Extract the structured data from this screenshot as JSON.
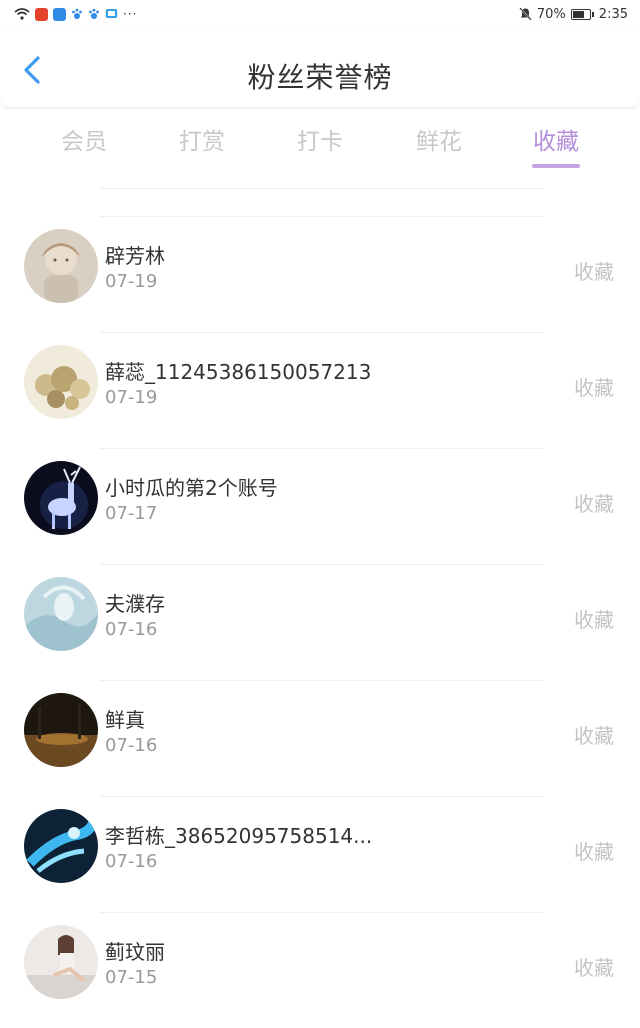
{
  "status_bar": {
    "battery": "70%",
    "time": "2:35",
    "icons": [
      "wifi-icon",
      "app-icon-red",
      "cloud-icon",
      "paw-icon",
      "paw-icon",
      "tv-icon",
      "more-icon",
      "mute-icon",
      "battery-icon"
    ],
    "colors": {
      "app_red": "#e2412c",
      "app_blue": "#2f8be5"
    }
  },
  "header": {
    "title": "粉丝荣誉榜",
    "back_icon": "chevron-left-icon",
    "accent": "#3b9cf0"
  },
  "tabs": {
    "items": [
      "会员",
      "打赏",
      "打卡",
      "鲜花",
      "收藏"
    ],
    "active_index": 4,
    "active_color": "#b48fd9",
    "inactive_color": "#c8c8c8"
  },
  "fans": [
    {
      "name": "辟芳林",
      "date": "07-19",
      "action": "收藏",
      "avatar": "avatar-sketch-girl"
    },
    {
      "name": "薛蕊_11245386150057213",
      "date": "07-19",
      "action": "收藏",
      "avatar": "avatar-gold-flowers"
    },
    {
      "name": "小时瓜的第2个账号",
      "date": "07-17",
      "action": "收藏",
      "avatar": "avatar-glowing-deer"
    },
    {
      "name": "夫濮存",
      "date": "07-16",
      "action": "收藏",
      "avatar": "avatar-ice-figure"
    },
    {
      "name": "鲜真",
      "date": "07-16",
      "action": "收藏",
      "avatar": "avatar-dark-forest"
    },
    {
      "name": "李哲栋_38652095758514...",
      "date": "07-16",
      "action": "收藏",
      "avatar": "avatar-blue-dragon"
    },
    {
      "name": "蓟玟丽",
      "date": "07-15",
      "action": "收藏",
      "avatar": "avatar-woman-photo"
    }
  ]
}
